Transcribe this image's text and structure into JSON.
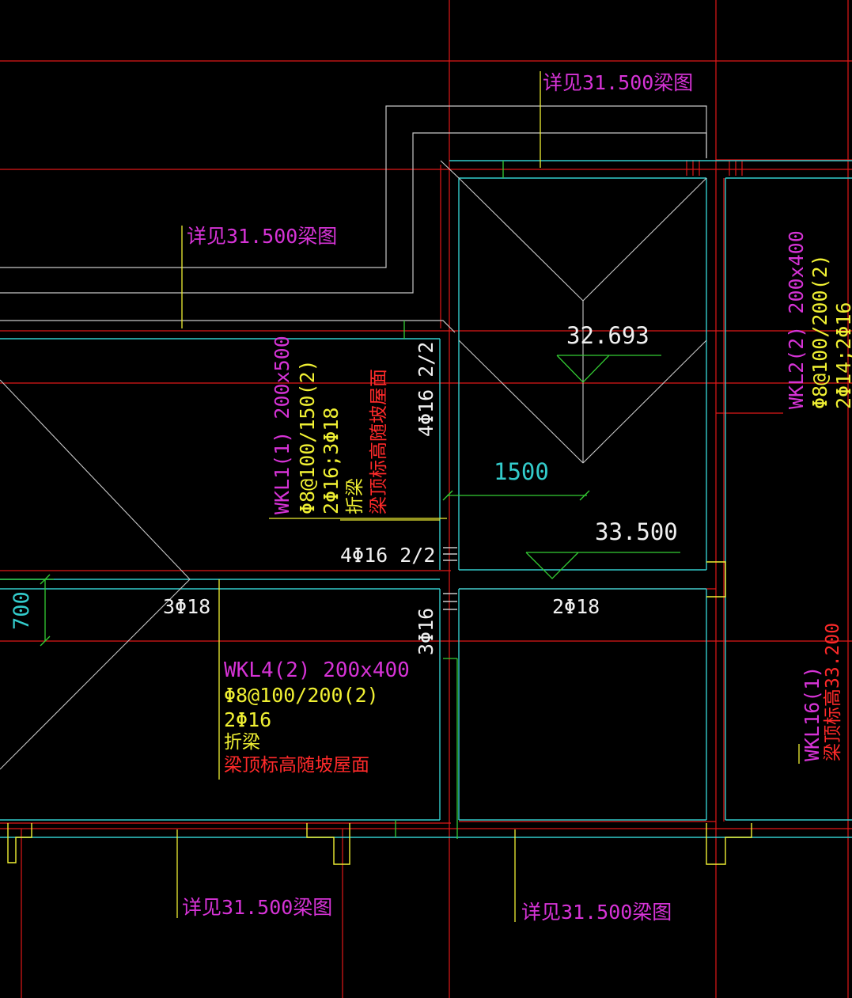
{
  "colors": {
    "background": "#000000",
    "axis_red": "#e01818",
    "beam_cyan": "#33cccc",
    "wall_gray": "#c8c8c8",
    "leader_yellow": "#f0f033",
    "dim_green": "#33cc33",
    "label_magenta": "#d633d6",
    "label_red": "#ff2a2a"
  },
  "references": {
    "ref_top": "详见31.500梁图",
    "ref_left": "详见31.500梁图",
    "ref_bottom_left": "详见31.500梁图",
    "ref_bottom_right": "详见31.500梁图"
  },
  "elevations": {
    "upper": "32.693",
    "lower": "33.500"
  },
  "dimensions": {
    "span_1500": "1500",
    "offset_700": "700"
  },
  "beams": {
    "wkl1": {
      "name": "WKL1(1) 200x500",
      "stirrup": "Φ8@100/150(2)",
      "bars": "2Φ16;3Φ18",
      "type": "折梁",
      "note": "梁顶标高随坡屋面"
    },
    "wkl4": {
      "name": "WKL4(2) 200x400",
      "stirrup": "Φ8@100/200(2)",
      "bars": "2Φ16",
      "type": "折梁",
      "note": "梁顶标高随坡屋面"
    },
    "wkl2": {
      "name": "WKL2(2) 200x400",
      "stirrup": "Φ8@100/200(2)",
      "bars": "2Φ14;2Φ16"
    },
    "wkl16": {
      "name": "WKL16(1)",
      "note": "梁顶标高33.200"
    }
  },
  "rebar": {
    "r_4phi16_vert": "4Φ16 2/2",
    "r_4phi16_horiz": "4Φ16 2/2",
    "r_3phi18": "3Φ18",
    "r_2phi18": "2Φ18",
    "r_3phi16": "3Φ16"
  }
}
